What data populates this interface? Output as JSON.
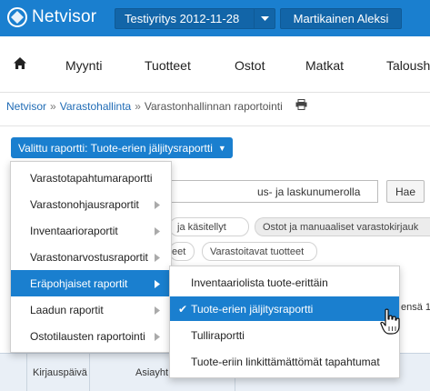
{
  "topbar": {
    "brand": "Netvisor",
    "company": "Testiyritys 2012-11-28",
    "user": "Martikainen Aleksi"
  },
  "mainnav": {
    "items": [
      "Myynti",
      "Tuotteet",
      "Ostot",
      "Matkat",
      "Taloush"
    ]
  },
  "breadcrumb": {
    "items": [
      "Netvisor",
      "Varastohallinta",
      "Varastonhallinnan raportointi"
    ],
    "separator": "»"
  },
  "report_selector": {
    "label": "Valittu raportti: Tuote-erien jäljitysraportti"
  },
  "background": {
    "search_value": "us- ja laskunumerolla",
    "search_button": "Hae",
    "chips_row1": [
      "ja käsitellyt",
      "Ostot ja manuaaliset varastokirjauk"
    ],
    "chips_row2": [
      "eet",
      "Varastoitavat tuotteet"
    ],
    "right_fragment": "ensä 1",
    "table_headers": [
      "Kirjauspäivä",
      "Asiayht"
    ]
  },
  "report_menu": {
    "items": [
      {
        "label": "Varastotapahtumaraportti",
        "has_submenu": false
      },
      {
        "label": "Varastonohjausraportit",
        "has_submenu": true
      },
      {
        "label": "Inventaarioraportit",
        "has_submenu": true
      },
      {
        "label": "Varastonarvostusraportit",
        "has_submenu": true
      },
      {
        "label": "Eräpohjaiset raportit",
        "has_submenu": true
      },
      {
        "label": "Laadun raportit",
        "has_submenu": true
      },
      {
        "label": "Ostotilausten raportointi",
        "has_submenu": true
      }
    ],
    "active": "Eräpohjaiset raportit"
  },
  "submenu": {
    "items": [
      "Inventaariolista tuote-erittäin",
      "Tuote-erien jäljitysraportti",
      "Tulliraportti",
      "Tuote-eriin linkittämättömät tapahtumat"
    ],
    "selected": "Tuote-erien jäljitysraportti"
  },
  "colors": {
    "primary": "#1a7fcf",
    "topbar_button": "#1265a8",
    "table_header": "#e9eff6"
  }
}
